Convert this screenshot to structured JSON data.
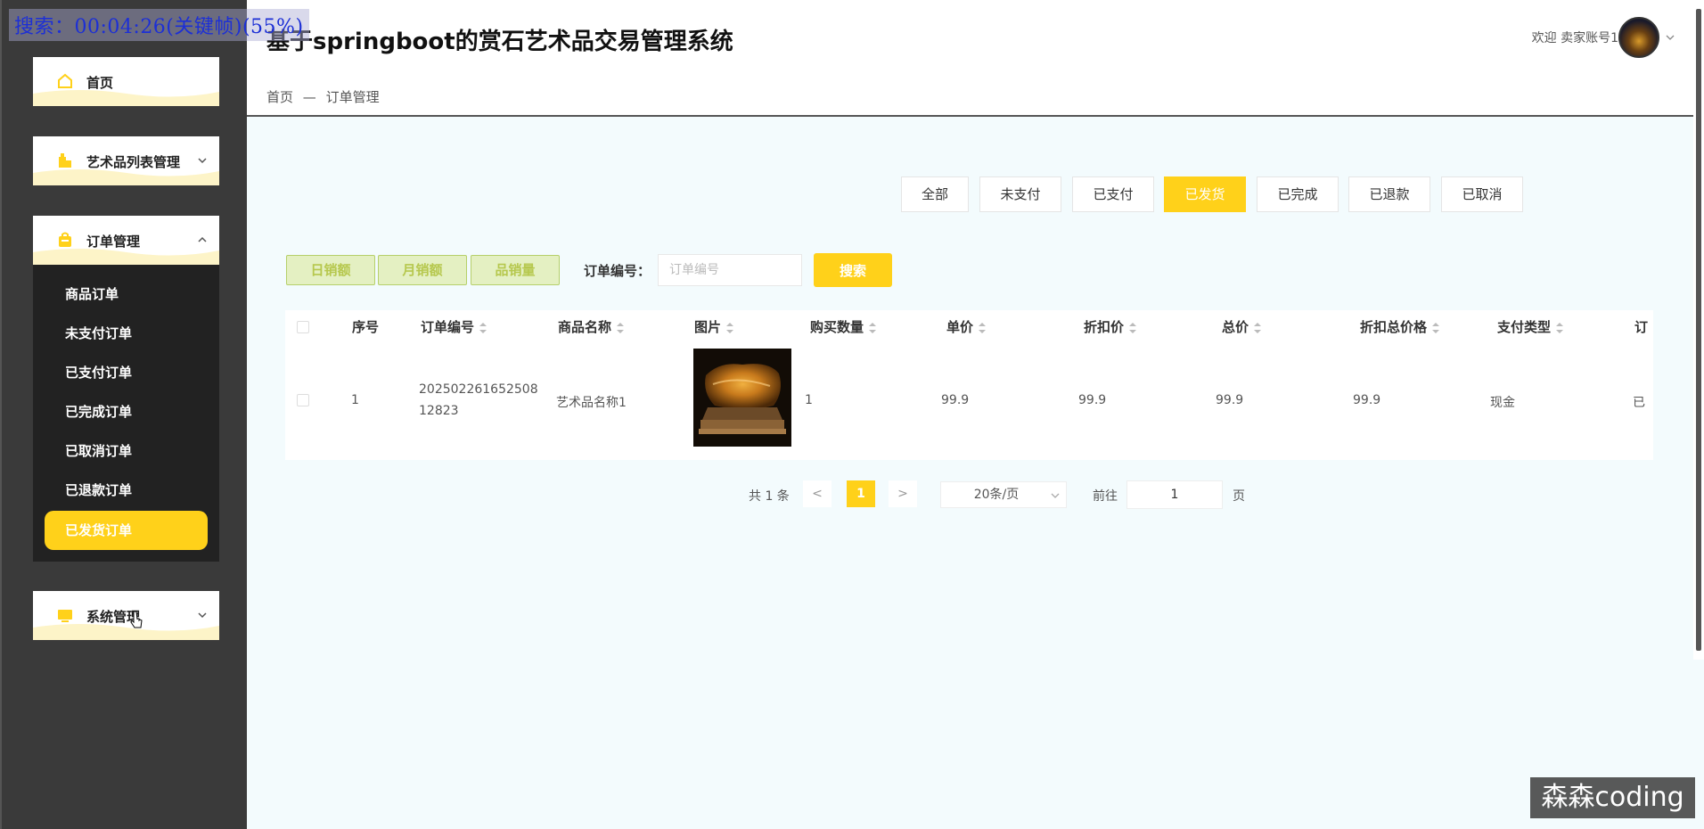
{
  "overlay": {
    "caption": "搜索：00:04:26(关键帧)(55%)"
  },
  "header": {
    "app_title": "基于springboot的赏石艺术品交易管理系统",
    "breadcrumb": [
      "首页",
      "—",
      "订单管理"
    ],
    "welcome": "欢迎 卖家账号1"
  },
  "sidebar": {
    "menus": [
      {
        "label": "首页",
        "icon": "home-icon"
      },
      {
        "label": "艺术品列表管理",
        "icon": "building-icon"
      },
      {
        "label": "订单管理",
        "icon": "bag-icon"
      },
      {
        "label": "系统管理",
        "icon": "monitor-icon"
      }
    ],
    "sub_items": [
      "商品订单",
      "未支付订单",
      "已支付订单",
      "已完成订单",
      "已取消订单",
      "已退款订单",
      "已发货订单"
    ],
    "active_sub": "已发货订单"
  },
  "tabs": [
    "全部",
    "未支付",
    "已支付",
    "已发货",
    "已完成",
    "已退款",
    "已取消"
  ],
  "active_tab": "已发货",
  "stats": [
    "日销额",
    "月销额",
    "品销量"
  ],
  "search": {
    "label": "订单编号：",
    "placeholder": "订单编号",
    "button": "搜索"
  },
  "table": {
    "columns": [
      "序号",
      "订单编号",
      "商品名称",
      "图片",
      "购买数量",
      "单价",
      "折扣价",
      "总价",
      "折扣总价格",
      "支付类型",
      "订"
    ],
    "rows": [
      {
        "index": "1",
        "order_no_line1": "202502261652508",
        "order_no_line2": "12823",
        "name": "艺术品名称1",
        "qty": "1",
        "price": "99.9",
        "discount_price": "99.9",
        "total": "99.9",
        "discount_total": "99.9",
        "pay_type": "现金",
        "status": "已"
      }
    ]
  },
  "pagination": {
    "total": "共 1 条",
    "prev": "<",
    "page": "1",
    "next": ">",
    "page_size": "20条/页",
    "goto_label": "前往",
    "goto_value": "1",
    "page_label": "页"
  },
  "watermark": "森森coding",
  "colors": {
    "accent": "#ffd11a",
    "sidebar_bg": "#3a3a3a",
    "main_bg": "#f3fbfd"
  }
}
